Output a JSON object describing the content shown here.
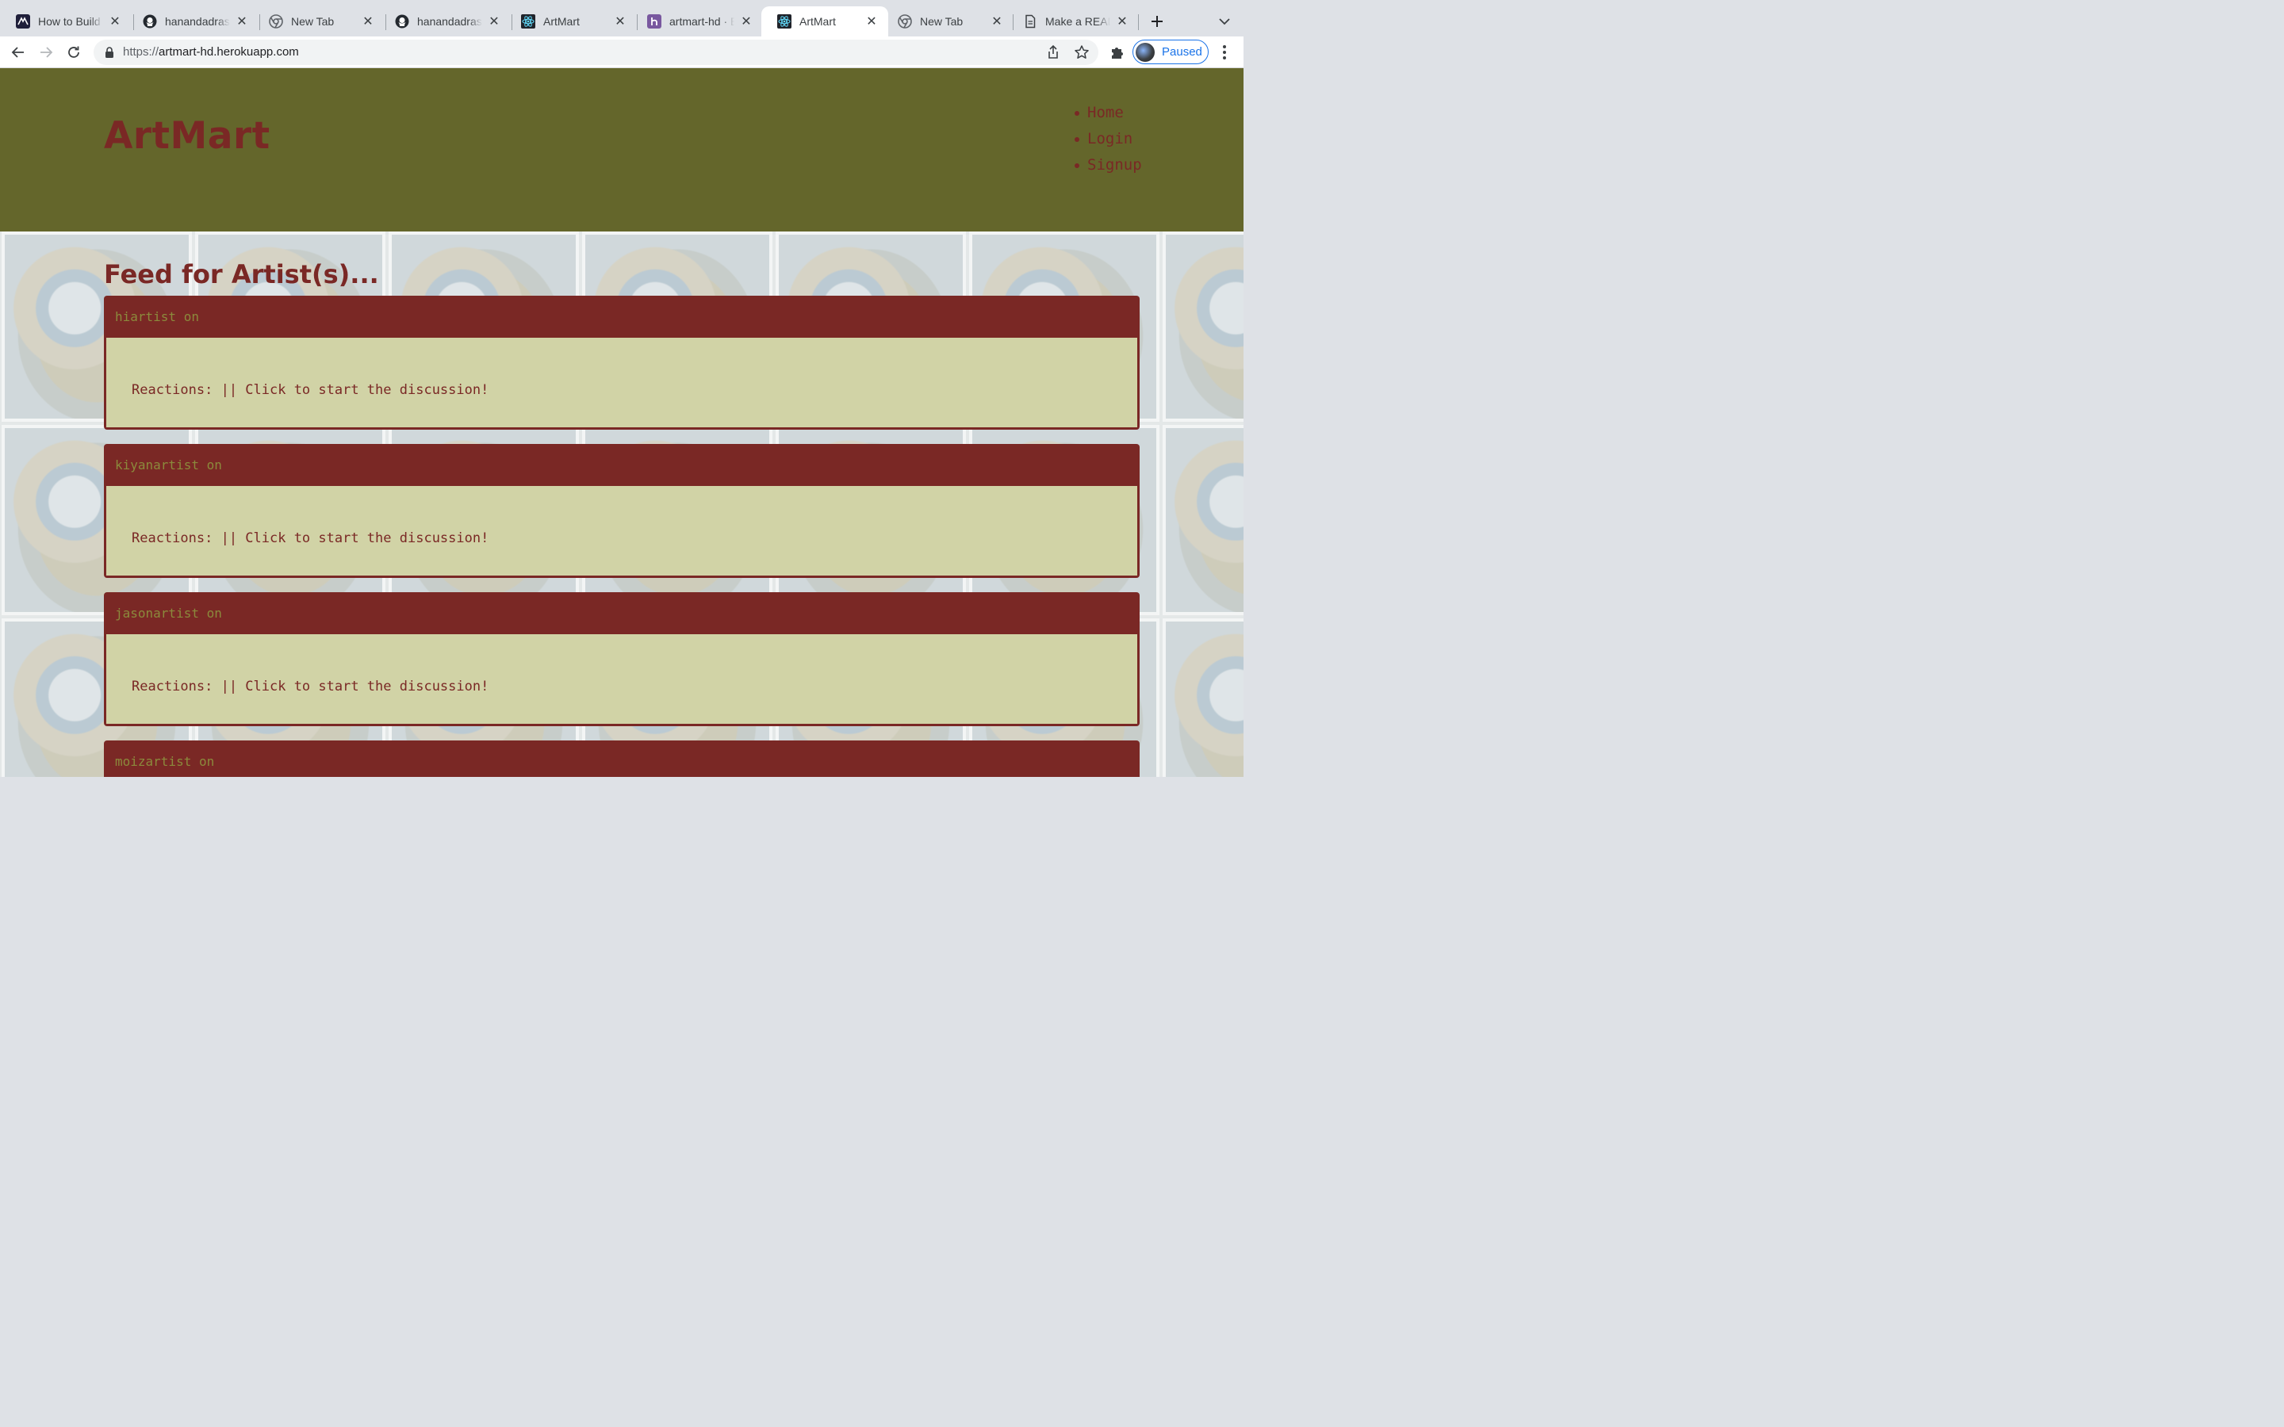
{
  "browser": {
    "tabs": [
      {
        "title": "How to Build a",
        "icon": "codeacademy-icon"
      },
      {
        "title": "hanandadras/A",
        "icon": "github-icon"
      },
      {
        "title": "New Tab",
        "icon": "chrome-icon"
      },
      {
        "title": "hanandadras/A",
        "icon": "github-icon"
      },
      {
        "title": "ArtMart",
        "icon": "react-icon"
      },
      {
        "title": "artmart-hd · B",
        "icon": "heroku-icon"
      },
      {
        "title": "ArtMart",
        "icon": "react-icon"
      },
      {
        "title": "New Tab",
        "icon": "chrome-icon"
      },
      {
        "title": "Make a READM",
        "icon": "document-icon"
      }
    ],
    "active_tab_index": 6,
    "url_scheme": "https://",
    "url_host": "artmart-hd.herokuapp.com",
    "profile_label": "Paused",
    "colors": {
      "tabstrip": "#dee1e6",
      "accent": "#1a73e8"
    }
  },
  "site": {
    "brand": "ArtMart",
    "nav": [
      "Home",
      "Login",
      "Signup"
    ],
    "feed_title": "Feed for Artist(s)...",
    "colors": {
      "header": "#64662b",
      "maroon": "#7a2825",
      "card_body": "#d1d3a6",
      "handle": "#8b8a3c"
    },
    "posts": [
      {
        "header": "hiartist on",
        "body": "Reactions: || Click to start the discussion!"
      },
      {
        "header": "kiyanartist on",
        "body": "Reactions: || Click to start the discussion!"
      },
      {
        "header": "jasonartist on",
        "body": "Reactions: || Click to start the discussion!"
      },
      {
        "header": "moizartist on",
        "body": ""
      }
    ]
  }
}
